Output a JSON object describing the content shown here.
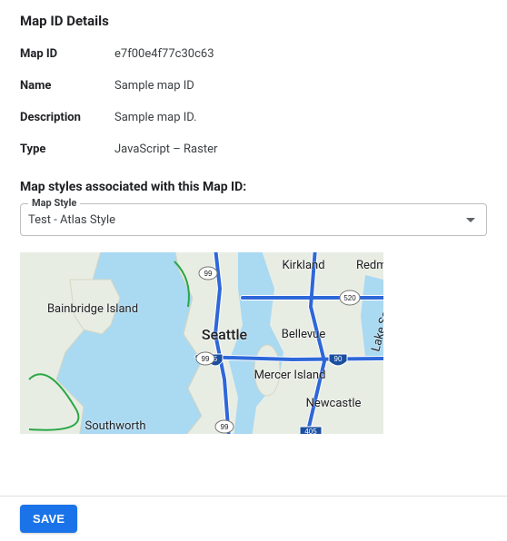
{
  "heading": "Map ID Details",
  "details": {
    "map_id": {
      "label": "Map ID",
      "value": "e7f00e4f77c30c63"
    },
    "name": {
      "label": "Name",
      "value": "Sample map ID"
    },
    "description": {
      "label": "Description",
      "value": "Sample map ID."
    },
    "type": {
      "label": "Type",
      "value": "JavaScript – Raster"
    }
  },
  "styles_heading": "Map styles associated with this Map ID:",
  "select": {
    "label": "Map Style",
    "value": "Test - Atlas Style"
  },
  "map": {
    "labels": {
      "seattle": "Seattle",
      "bellevue": "Bellevue",
      "kirkland": "Kirkland",
      "redmond": "Redmond",
      "bainbridge": "Bainbridge Island",
      "mercer": "Mercer Island",
      "newcastle": "Newcastle",
      "southworth": "Southworth",
      "sammamish": "Lake Sammamish"
    },
    "shields": {
      "i5": "5",
      "i90": "90",
      "i405": "405",
      "sr520": "520",
      "sr99a": "99",
      "sr99b": "99",
      "sr99c": "99"
    }
  },
  "save_label": "SAVE"
}
